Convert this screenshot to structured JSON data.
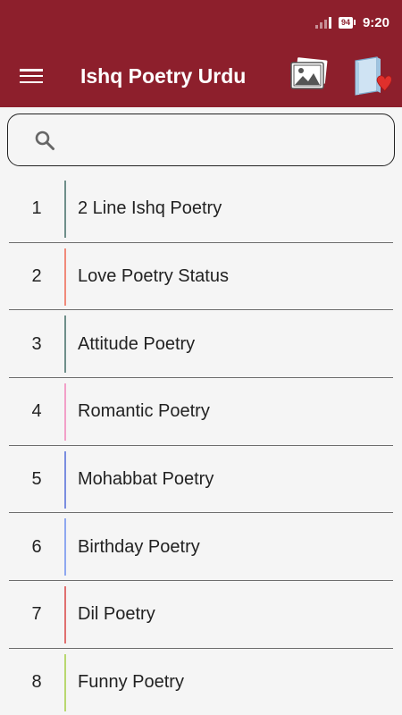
{
  "status_bar": {
    "battery": "94",
    "time": "9:20"
  },
  "toolbar": {
    "title": "Ishq Poetry Urdu",
    "menu_icon": "hamburger-menu-icon",
    "gallery_icon": "image-gallery-icon",
    "favorites_icon": "heart-book-icon"
  },
  "search": {
    "placeholder": "",
    "value": "",
    "icon": "search-icon"
  },
  "categories": [
    {
      "number": "1",
      "label": "2 Line Ishq Poetry",
      "accent": "#6f8f8a"
    },
    {
      "number": "2",
      "label": "Love Poetry Status",
      "accent": "#f08a7a"
    },
    {
      "number": "3",
      "label": "Attitude Poetry",
      "accent": "#6f8f8a"
    },
    {
      "number": "4",
      "label": "Romantic Poetry",
      "accent": "#f2a0c8"
    },
    {
      "number": "5",
      "label": "Mohabbat Poetry",
      "accent": "#7a8ee0"
    },
    {
      "number": "6",
      "label": "Birthday Poetry",
      "accent": "#8fa8f0"
    },
    {
      "number": "7",
      "label": "Dil Poetry",
      "accent": "#e07070"
    },
    {
      "number": "8",
      "label": "Funny Poetry",
      "accent": "#b8d870"
    }
  ],
  "colors": {
    "app_bar": "#8d1f2c",
    "background": "#f5f5f5"
  }
}
